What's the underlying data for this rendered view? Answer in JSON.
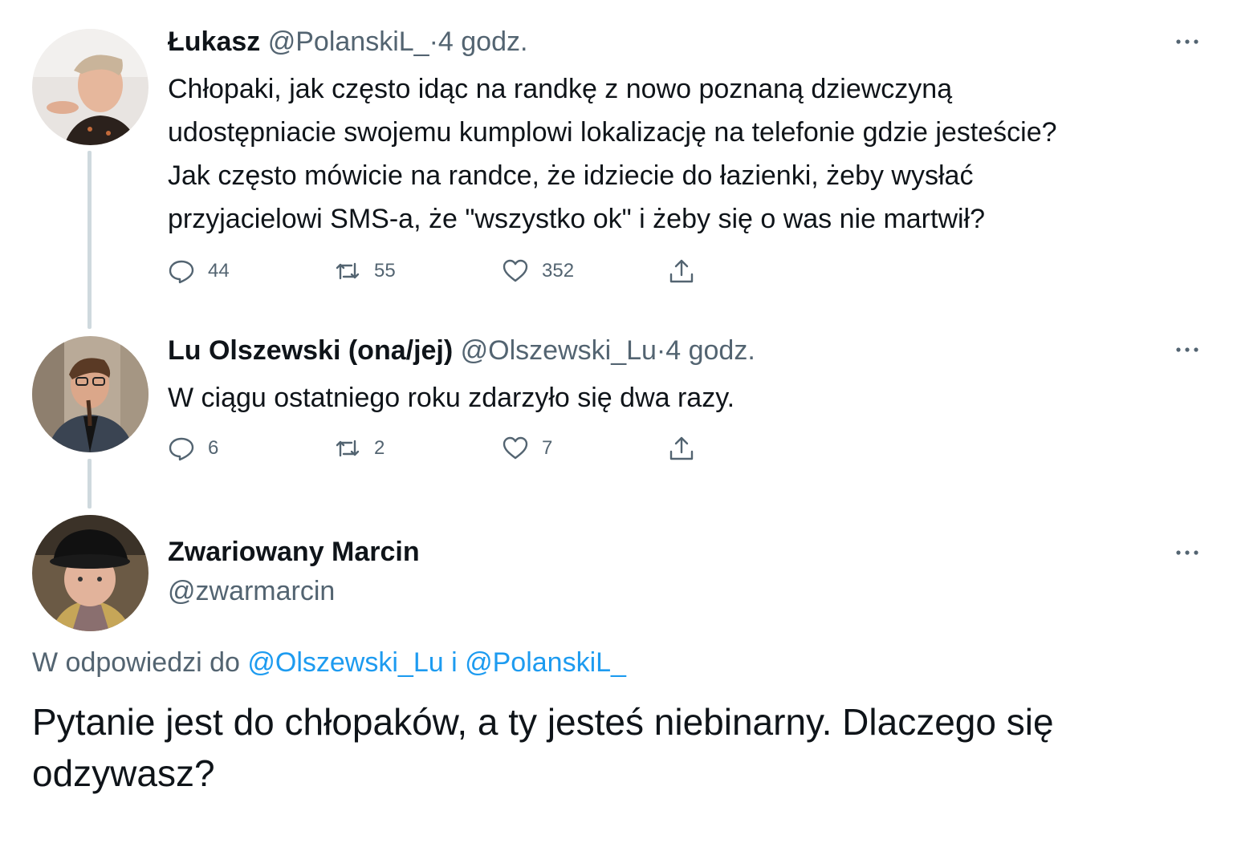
{
  "tweets": [
    {
      "name": "Łukasz",
      "handle": "@PolanskiL_",
      "dot": "·",
      "time": "4 godz.",
      "lines": [
        "Chłopaki, jak często idąc na randkę z nowo poznaną dziewczyną",
        "udostępniacie swojemu kumplowi lokalizację na telefonie gdzie jesteście?",
        "Jak często mówicie na randce, że idziecie do łazienki, żeby wysłać",
        "przyjacielowi SMS-a, że \"wszystko ok\" i żeby się o was nie martwił?"
      ],
      "replies": "44",
      "retweets": "55",
      "likes": "352"
    },
    {
      "name": "Lu Olszewski (ona/jej)",
      "handle": "@Olszewski_Lu",
      "dot": "·",
      "time": "4 godz.",
      "lines": [
        "W ciągu ostatniego roku zdarzyło się dwa razy."
      ],
      "replies": "6",
      "retweets": "2",
      "likes": "7"
    }
  ],
  "main_tweet": {
    "name": "Zwariowany Marcin",
    "handle": "@zwarmarcin",
    "reply_prefix": "W odpowiedzi do",
    "reply_mention_1": "@Olszewski_Lu",
    "reply_joiner": "i",
    "reply_mention_2": "@PolanskiL_",
    "lines": [
      "Pytanie jest do chłopaków, a ty jesteś niebinarny. Dlaczego się",
      "odzywasz?"
    ]
  },
  "icons": {
    "reply": "reply-icon",
    "retweet": "retweet-icon",
    "like": "heart-icon",
    "share": "share-icon",
    "more": "more-icon"
  },
  "colors": {
    "text": "#0f1419",
    "secondary": "#536471",
    "link": "#1d9bf0",
    "thread_line": "#cfd9de"
  }
}
